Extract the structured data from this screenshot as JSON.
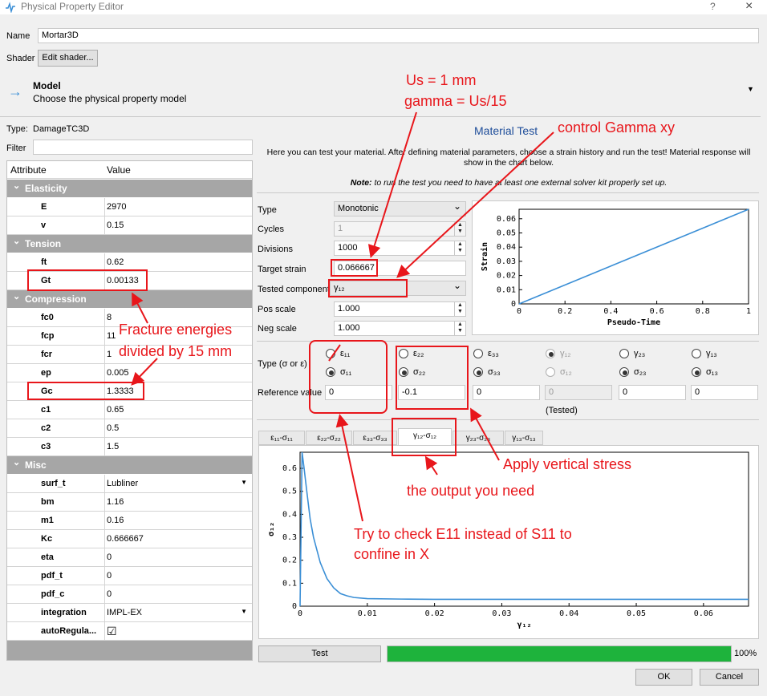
{
  "window": {
    "title": "Physical Property Editor",
    "help": "?",
    "close": "×"
  },
  "name_field": {
    "label": "Name",
    "value": "Mortar3D"
  },
  "shader": {
    "label": "Shader",
    "button": "Edit shader..."
  },
  "model": {
    "title": "Model",
    "subtitle": "Choose the physical property model"
  },
  "type_line": {
    "label": "Type:",
    "value": "DamageTC3D"
  },
  "filter": {
    "label": "Filter",
    "value": ""
  },
  "table": {
    "headers": [
      "Attribute",
      "Value"
    ],
    "groups": {
      "elasticity": "Elasticity",
      "tension": "Tension",
      "compression": "Compression",
      "misc": "Misc"
    },
    "rows": {
      "E": "2970",
      "v": "0.15",
      "ft": "0.62",
      "Gt": "0.00133",
      "fc0": "8",
      "fcp": "11",
      "fcr": "1",
      "ep": "0.005",
      "Gc": "1.3333",
      "c1": "0.65",
      "c2": "0.5",
      "c3": "1.5",
      "surf_t": "Lubliner",
      "bm": "1.16",
      "m1": "0.16",
      "Kc": "0.666667",
      "eta": "0",
      "pdf_t": "0",
      "pdf_c": "0",
      "integration": "IMPL-EX",
      "autoRegula": "☑"
    },
    "keys": {
      "E": "E",
      "v": "v",
      "ft": "ft",
      "Gt": "Gt",
      "fc0": "fc0",
      "fcp": "fcp",
      "fcr": "fcr",
      "ep": "ep",
      "Gc": "Gc",
      "c1": "c1",
      "c2": "c2",
      "c3": "c3",
      "surf_t": "surf_t",
      "bm": "bm",
      "m1": "m1",
      "Kc": "Kc",
      "eta": "eta",
      "pdf_t": "pdf_t",
      "pdf_c": "pdf_c",
      "integration": "integration",
      "autoRegula": "autoRegula..."
    }
  },
  "material_test": {
    "title": "Material Test",
    "intro": "Here you can test your material. After defining material parameters, choose a strain history and run the test! Material response will show in the chart below.",
    "note_bold": "Note:",
    "note_text": " to run the test you need to have at least one external solver kit properly set up.",
    "type": {
      "label": "Type",
      "value": "Monotonic"
    },
    "cycles": {
      "label": "Cycles",
      "value": "1"
    },
    "divisions": {
      "label": "Divisions",
      "value": "1000"
    },
    "target_strain": {
      "label": "Target strain",
      "value": "0.066667"
    },
    "tested_component": {
      "label": "Tested component",
      "value": "γ₁₂"
    },
    "pos_scale": {
      "label": "Pos scale",
      "value": "1.000"
    },
    "neg_scale": {
      "label": "Neg scale",
      "value": "1.000"
    },
    "type_sigma_eps_label": "Type (σ or ε)",
    "reference_label": "Reference value",
    "strain_labels": [
      "ε₁₁",
      "ε₂₂",
      "ε₃₃",
      "γ₁₂",
      "γ₂₃",
      "γ₁₃"
    ],
    "stress_labels": [
      "σ₁₁",
      "σ₂₂",
      "σ₃₃",
      "σ₁₂",
      "σ₂₃",
      "σ₁₃"
    ],
    "reference_values": [
      "0",
      "-0.1",
      "0",
      "0",
      "0",
      "0"
    ],
    "tested_note": "(Tested)",
    "tabs": [
      "ε₁₁-σ₁₁",
      "ε₂₂-σ₂₂",
      "ε₃₃-σ₃₃",
      "γ₁₂-σ₁₂",
      "γ₂₃-σ₂₃",
      "γ₁₃-σ₁₃"
    ],
    "test_button": "Test",
    "progress_percent": 100,
    "progress_label": "100%"
  },
  "buttons": {
    "ok": "OK",
    "cancel": "Cancel"
  },
  "annotations": {
    "us": "Us = 1 mm",
    "gamma": "gamma = Us/15",
    "control": "control Gamma xy",
    "fracture1": "Fracture energies",
    "fracture2": "divided by 15 mm",
    "apply": "Apply vertical stress",
    "output": "the output you need",
    "try1": "Try to check E11 instead of S11 to",
    "try2": "confine in X"
  },
  "colors": {
    "accent": "#3b8fd6",
    "annotation": "#e8161b",
    "progress": "#1eb33c",
    "group_header": "#a6a6a6"
  },
  "chart_data": [
    {
      "type": "line",
      "xlabel": "Pseudo-Time",
      "ylabel": "Strain",
      "xlim": [
        0,
        1
      ],
      "ylim": [
        0,
        0.066667
      ],
      "xticks": [
        "0",
        "0.2",
        "0.4",
        "0.6",
        "0.8",
        "1"
      ],
      "yticks": [
        "0",
        "0.01",
        "0.02",
        "0.03",
        "0.04",
        "0.05",
        "0.06"
      ],
      "series": [
        {
          "x": [
            0,
            1
          ],
          "y": [
            0,
            0.066667
          ]
        }
      ]
    },
    {
      "type": "line",
      "xlabel": "γ₁₂",
      "ylabel": "σ₁₂",
      "xlim": [
        0,
        0.0667
      ],
      "ylim": [
        0,
        0.67
      ],
      "xticks": [
        "0",
        "0.01",
        "0.02",
        "0.03",
        "0.04",
        "0.05",
        "0.06"
      ],
      "yticks": [
        "0",
        "0.1",
        "0.2",
        "0.3",
        "0.4",
        "0.5",
        "0.6"
      ],
      "series": [
        {
          "x": [
            0,
            0.0003,
            0.0006,
            0.001,
            0.0015,
            0.002,
            0.003,
            0.004,
            0.005,
            0.006,
            0.007,
            0.008,
            0.01,
            0.015,
            0.02,
            0.03,
            0.04,
            0.05,
            0.06,
            0.0667
          ],
          "y": [
            0,
            0.67,
            0.6,
            0.5,
            0.38,
            0.3,
            0.19,
            0.12,
            0.08,
            0.055,
            0.045,
            0.038,
            0.033,
            0.031,
            0.03,
            0.03,
            0.03,
            0.03,
            0.03,
            0.03
          ]
        }
      ]
    }
  ]
}
